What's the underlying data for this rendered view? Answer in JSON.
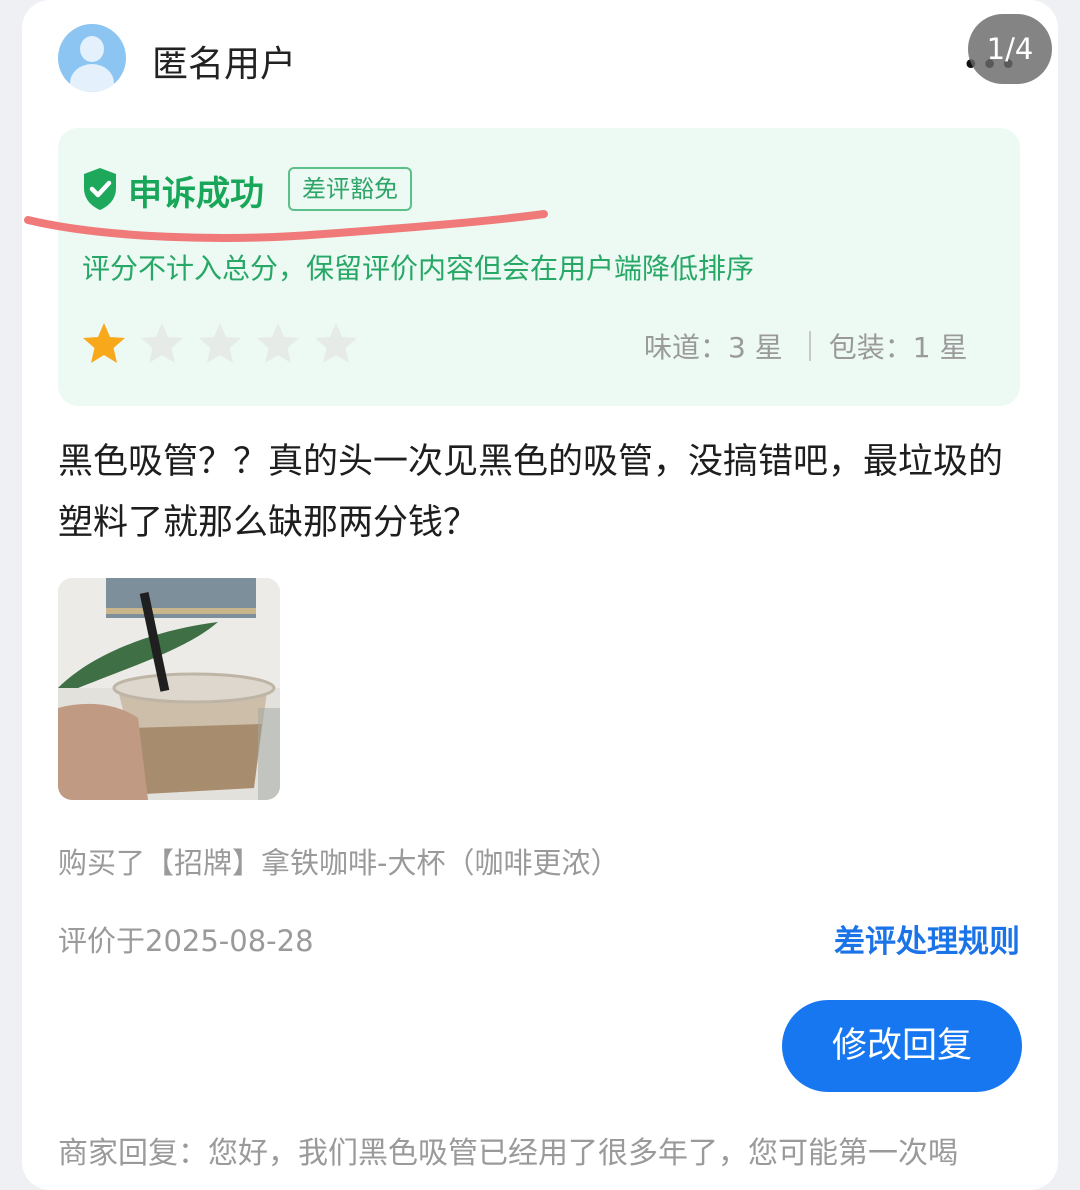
{
  "user": {
    "name": "匿名用户"
  },
  "pager": {
    "text": "1/4"
  },
  "more": {
    "glyph": "•••"
  },
  "appeal": {
    "status": "申诉成功",
    "tag": "差评豁免",
    "note": "评分不计入总分，保留评价内容但会在用户端降低排序",
    "status_color": "#18a659"
  },
  "rating": {
    "overall_stars": 1,
    "max_stars": 5,
    "taste_label": "味道：",
    "taste_value": "3 星",
    "packaging_label": "包装：",
    "packaging_value": "1 星"
  },
  "review": {
    "text": "黑色吸管？？真的头一次见黑色的吸管，没搞错吧，最垃圾的塑料了就那么缺那两分钱？",
    "purchase": "购买了【招牌】拿铁咖啡-大杯（咖啡更浓）",
    "date": "评价于2025-08-28"
  },
  "actions": {
    "rules_link": "差评处理规则",
    "edit_reply": "修改回复"
  },
  "merchant": {
    "reply": "商家回复：您好，我们黑色吸管已经用了很多年了，您可能第一次喝"
  },
  "colors": {
    "accent": "#1677f0",
    "appeal_bg": "#edf9f3",
    "star_active": "#f7a81b",
    "star_inactive": "#e9ece9",
    "highlight": "#ee6b6b"
  }
}
